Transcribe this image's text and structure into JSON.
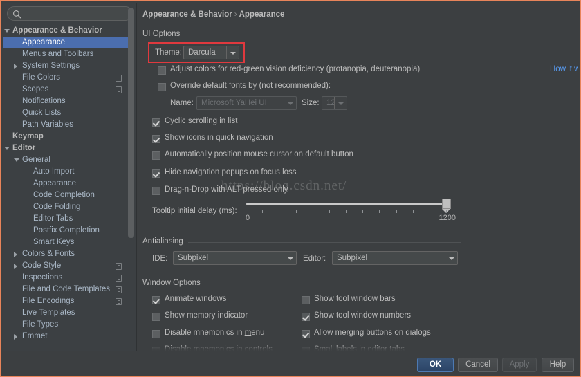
{
  "window": {
    "border_color": "#e8845a",
    "background": "#3c3f41",
    "accent_selection": "#4b6eaf",
    "link_color": "#589df6",
    "highlight_box_color": "#e0393e"
  },
  "watermark": {
    "text": "https://blog.csdn.net/"
  },
  "sidebar": {
    "search": {
      "value": "",
      "placeholder": "",
      "icon": "search-icon"
    },
    "items": [
      {
        "label": "Appearance & Behavior",
        "indent": 0,
        "arrow": "open",
        "bold": true,
        "selected": false,
        "copy": false
      },
      {
        "label": "Appearance",
        "indent": 1,
        "arrow": "none",
        "bold": false,
        "selected": true,
        "copy": false
      },
      {
        "label": "Menus and Toolbars",
        "indent": 1,
        "arrow": "none",
        "bold": false,
        "selected": false,
        "copy": false
      },
      {
        "label": "System Settings",
        "indent": 1,
        "arrow": "closed",
        "bold": false,
        "selected": false,
        "copy": false
      },
      {
        "label": "File Colors",
        "indent": 1,
        "arrow": "none",
        "bold": false,
        "selected": false,
        "copy": true
      },
      {
        "label": "Scopes",
        "indent": 1,
        "arrow": "none",
        "bold": false,
        "selected": false,
        "copy": true
      },
      {
        "label": "Notifications",
        "indent": 1,
        "arrow": "none",
        "bold": false,
        "selected": false,
        "copy": false
      },
      {
        "label": "Quick Lists",
        "indent": 1,
        "arrow": "none",
        "bold": false,
        "selected": false,
        "copy": false
      },
      {
        "label": "Path Variables",
        "indent": 1,
        "arrow": "none",
        "bold": false,
        "selected": false,
        "copy": false
      },
      {
        "label": "Keymap",
        "indent": 0,
        "arrow": "none",
        "bold": true,
        "selected": false,
        "copy": false
      },
      {
        "label": "Editor",
        "indent": 0,
        "arrow": "open",
        "bold": true,
        "selected": false,
        "copy": false
      },
      {
        "label": "General",
        "indent": 1,
        "arrow": "open",
        "bold": false,
        "selected": false,
        "copy": false
      },
      {
        "label": "Auto Import",
        "indent": 2,
        "arrow": "none",
        "bold": false,
        "selected": false,
        "copy": false
      },
      {
        "label": "Appearance",
        "indent": 2,
        "arrow": "none",
        "bold": false,
        "selected": false,
        "copy": false
      },
      {
        "label": "Code Completion",
        "indent": 2,
        "arrow": "none",
        "bold": false,
        "selected": false,
        "copy": false
      },
      {
        "label": "Code Folding",
        "indent": 2,
        "arrow": "none",
        "bold": false,
        "selected": false,
        "copy": false
      },
      {
        "label": "Editor Tabs",
        "indent": 2,
        "arrow": "none",
        "bold": false,
        "selected": false,
        "copy": false
      },
      {
        "label": "Postfix Completion",
        "indent": 2,
        "arrow": "none",
        "bold": false,
        "selected": false,
        "copy": false
      },
      {
        "label": "Smart Keys",
        "indent": 2,
        "arrow": "none",
        "bold": false,
        "selected": false,
        "copy": false
      },
      {
        "label": "Colors & Fonts",
        "indent": 1,
        "arrow": "closed",
        "bold": false,
        "selected": false,
        "copy": false
      },
      {
        "label": "Code Style",
        "indent": 1,
        "arrow": "closed",
        "bold": false,
        "selected": false,
        "copy": true
      },
      {
        "label": "Inspections",
        "indent": 1,
        "arrow": "none",
        "bold": false,
        "selected": false,
        "copy": true
      },
      {
        "label": "File and Code Templates",
        "indent": 1,
        "arrow": "none",
        "bold": false,
        "selected": false,
        "copy": true
      },
      {
        "label": "File Encodings",
        "indent": 1,
        "arrow": "none",
        "bold": false,
        "selected": false,
        "copy": true
      },
      {
        "label": "Live Templates",
        "indent": 1,
        "arrow": "none",
        "bold": false,
        "selected": false,
        "copy": false
      },
      {
        "label": "File Types",
        "indent": 1,
        "arrow": "none",
        "bold": false,
        "selected": false,
        "copy": false
      },
      {
        "label": "Emmet",
        "indent": 1,
        "arrow": "closed",
        "bold": false,
        "selected": false,
        "copy": false
      }
    ]
  },
  "main": {
    "breadcrumb": {
      "parent": "Appearance & Behavior",
      "separator": "›",
      "current": "Appearance"
    },
    "ui_options": {
      "title": "UI Options",
      "theme_label": "Theme:",
      "theme_value": "Darcula",
      "adjust_colors": {
        "label": "Adjust colors for red-green vision deficiency (protanopia, deuteranopia)",
        "checked": false
      },
      "how_it_works_link": "How it works",
      "override_fonts": {
        "label": "Override default fonts by (not recommended):",
        "checked": false
      },
      "font_name_label": "Name:",
      "font_name_value": "Microsoft YaHei UI",
      "font_size_label": "Size:",
      "font_size_value": "12",
      "checkboxes": [
        {
          "label": "Cyclic scrolling in list",
          "checked": true
        },
        {
          "label": "Show icons in quick navigation",
          "checked": true
        },
        {
          "label": "Automatically position mouse cursor on default button",
          "checked": false
        },
        {
          "label": "Hide navigation popups on focus loss",
          "checked": true
        },
        {
          "label": "Drag-n-Drop with ALT pressed only",
          "checked": false
        }
      ],
      "tooltip_delay": {
        "label": "Tooltip initial delay (ms):",
        "min": "0",
        "max": "1200",
        "value": 1200,
        "tick_count": 13
      }
    },
    "antialiasing": {
      "title": "Antialiasing",
      "ide_label": "IDE:",
      "ide_value": "Subpixel",
      "editor_label": "Editor:",
      "editor_value": "Subpixel"
    },
    "window_options": {
      "title": "Window Options",
      "left_column": [
        {
          "label": "Animate windows",
          "checked": true
        },
        {
          "label": "Show memory indicator",
          "checked": false
        },
        {
          "label": "Disable mnemonics in menu",
          "checked": false,
          "mnemonic": "m"
        },
        {
          "label": "Disable mnemonics in controls",
          "checked": false,
          "clipped": true
        }
      ],
      "right_column": [
        {
          "label": "Show tool window bars",
          "checked": false
        },
        {
          "label": "Show tool window numbers",
          "checked": true
        },
        {
          "label": "Allow merging buttons on dialogs",
          "checked": true
        },
        {
          "label": "Small labels in editor tabs",
          "checked": false,
          "clipped": true
        }
      ]
    }
  },
  "buttons": {
    "ok": "OK",
    "cancel": "Cancel",
    "apply": "Apply",
    "apply_enabled": false,
    "help": "Help"
  }
}
